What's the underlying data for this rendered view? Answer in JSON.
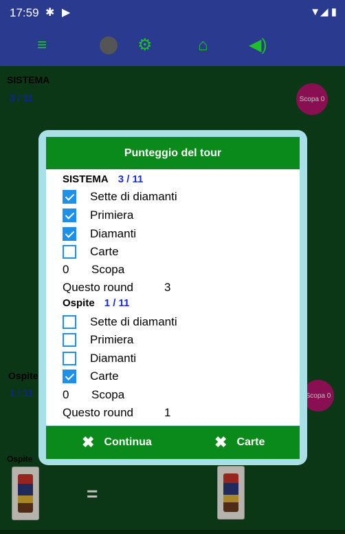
{
  "status_bar": {
    "time": "17:59"
  },
  "toolbar": {
    "items": [
      "menu-icon",
      "record-dot",
      "gears-icon",
      "home-icon",
      "volume-icon"
    ]
  },
  "table": {
    "player_top": {
      "name": "SISTEMA",
      "count": "3 / 11",
      "badge": "Scopa 0"
    },
    "player_bottom": {
      "name": "Ospite",
      "count": "1 / 11",
      "badge": "Scopa 0"
    },
    "hand_label": "Ospite",
    "equals": "="
  },
  "dialog": {
    "title": "Punteggio del tour",
    "sistema": {
      "name": "SISTEMA",
      "count": "3 / 11",
      "rows": [
        {
          "label": "Sette di diamanti",
          "checked": true
        },
        {
          "label": "Primiera",
          "checked": true
        },
        {
          "label": "Diamanti",
          "checked": true
        },
        {
          "label": "Carte",
          "checked": false
        }
      ],
      "scopa_value": "0",
      "scopa_label": "Scopa",
      "round_label": "Questo round",
      "round_value": "3"
    },
    "ospite": {
      "name": "Ospite",
      "count": "1 / 11",
      "rows": [
        {
          "label": "Sette di diamanti",
          "checked": false
        },
        {
          "label": "Primiera",
          "checked": false
        },
        {
          "label": "Diamanti",
          "checked": false
        },
        {
          "label": "Carte",
          "checked": true
        }
      ],
      "scopa_value": "0",
      "scopa_label": "Scopa",
      "round_label": "Questo round",
      "round_value": "1"
    },
    "buttons": {
      "continue": "Continua",
      "cards": "Carte"
    }
  },
  "colors": {
    "accent_green": "#0a8a1a",
    "toolbar_blue": "#2a3a8f",
    "check_blue": "#1e90e8",
    "badge_magenta": "#b8156e"
  }
}
